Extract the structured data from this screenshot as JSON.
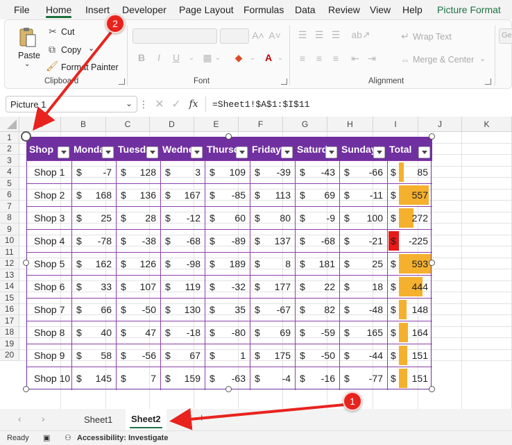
{
  "menu": [
    "File",
    "Home",
    "Insert",
    "Developer",
    "Page Layout",
    "Formulas",
    "Data",
    "Review",
    "View",
    "Help",
    "Picture Format"
  ],
  "ribbon": {
    "paste": "Paste",
    "cut": "Cut",
    "copy": "Copy",
    "format_painter": "Format Painter",
    "clipboard_label": "Clipboard",
    "font_label": "Font",
    "wrap_text": "Wrap Text",
    "merge_center": "Merge & Center",
    "alignment_label": "Alignment",
    "number_format_partial": "Ge"
  },
  "formula_bar": {
    "name_box": "Picture 1",
    "fx": "fx",
    "formula": "=Sheet1!$A$1:$I$11"
  },
  "grid": {
    "columns": [
      "A",
      "B",
      "C",
      "D",
      "E",
      "F",
      "G",
      "H",
      "I",
      "J",
      "K"
    ],
    "rows": [
      "1",
      "2",
      "3",
      "4",
      "5",
      "6",
      "7",
      "8",
      "9",
      "10",
      "11",
      "12",
      "13",
      "14",
      "15",
      "16",
      "17",
      "18",
      "19",
      "20"
    ]
  },
  "table": {
    "headers": [
      "Shop",
      "Monday",
      "Tuesday",
      "Wednesday",
      "Thursday",
      "Friday",
      "Saturday",
      "Sunday",
      "Total"
    ],
    "currency": "$",
    "rows": [
      {
        "shop": "Shop 1",
        "values": [
          "-7",
          "128",
          "3",
          "109",
          "-39",
          "-43",
          "-66"
        ],
        "total": "85",
        "total_value": 85
      },
      {
        "shop": "Shop 2",
        "values": [
          "168",
          "136",
          "167",
          "-85",
          "113",
          "69",
          "-11"
        ],
        "total": "557",
        "total_value": 557
      },
      {
        "shop": "Shop 3",
        "values": [
          "25",
          "28",
          "-12",
          "60",
          "80",
          "-9",
          "100"
        ],
        "total": "272",
        "total_value": 272
      },
      {
        "shop": "Shop 4",
        "values": [
          "-78",
          "-38",
          "-68",
          "-89",
          "137",
          "-68",
          "-21"
        ],
        "total": "-225",
        "total_value": -225
      },
      {
        "shop": "Shop 5",
        "values": [
          "162",
          "126",
          "-98",
          "189",
          "8",
          "181",
          "25"
        ],
        "total": "593",
        "total_value": 593
      },
      {
        "shop": "Shop 6",
        "values": [
          "33",
          "107",
          "119",
          "-32",
          "177",
          "22",
          "18"
        ],
        "total": "444",
        "total_value": 444
      },
      {
        "shop": "Shop 7",
        "values": [
          "66",
          "-50",
          "130",
          "35",
          "-67",
          "82",
          "-48"
        ],
        "total": "148",
        "total_value": 148
      },
      {
        "shop": "Shop 8",
        "values": [
          "40",
          "47",
          "-18",
          "-80",
          "69",
          "-59",
          "165"
        ],
        "total": "164",
        "total_value": 164
      },
      {
        "shop": "Shop 9",
        "values": [
          "58",
          "-56",
          "67",
          "1",
          "175",
          "-50",
          "-44"
        ],
        "total": "151",
        "total_value": 151
      },
      {
        "shop": "Shop 10",
        "values": [
          "145",
          "7",
          "159",
          "-63",
          "-4",
          "-16",
          "-77"
        ],
        "total": "151",
        "total_value": 151
      }
    ],
    "bar_color_positive": "#f5b02e",
    "bar_color_negative": "#e81919",
    "header_color": "#7030a0"
  },
  "sheet_tabs": [
    "Sheet1",
    "Sheet2"
  ],
  "active_tab": "Sheet2",
  "status": {
    "ready": "Ready",
    "accessibility": "Accessibility: Investigate"
  },
  "annotations": [
    "1",
    "2"
  ],
  "annotation_color": "#e8231e"
}
